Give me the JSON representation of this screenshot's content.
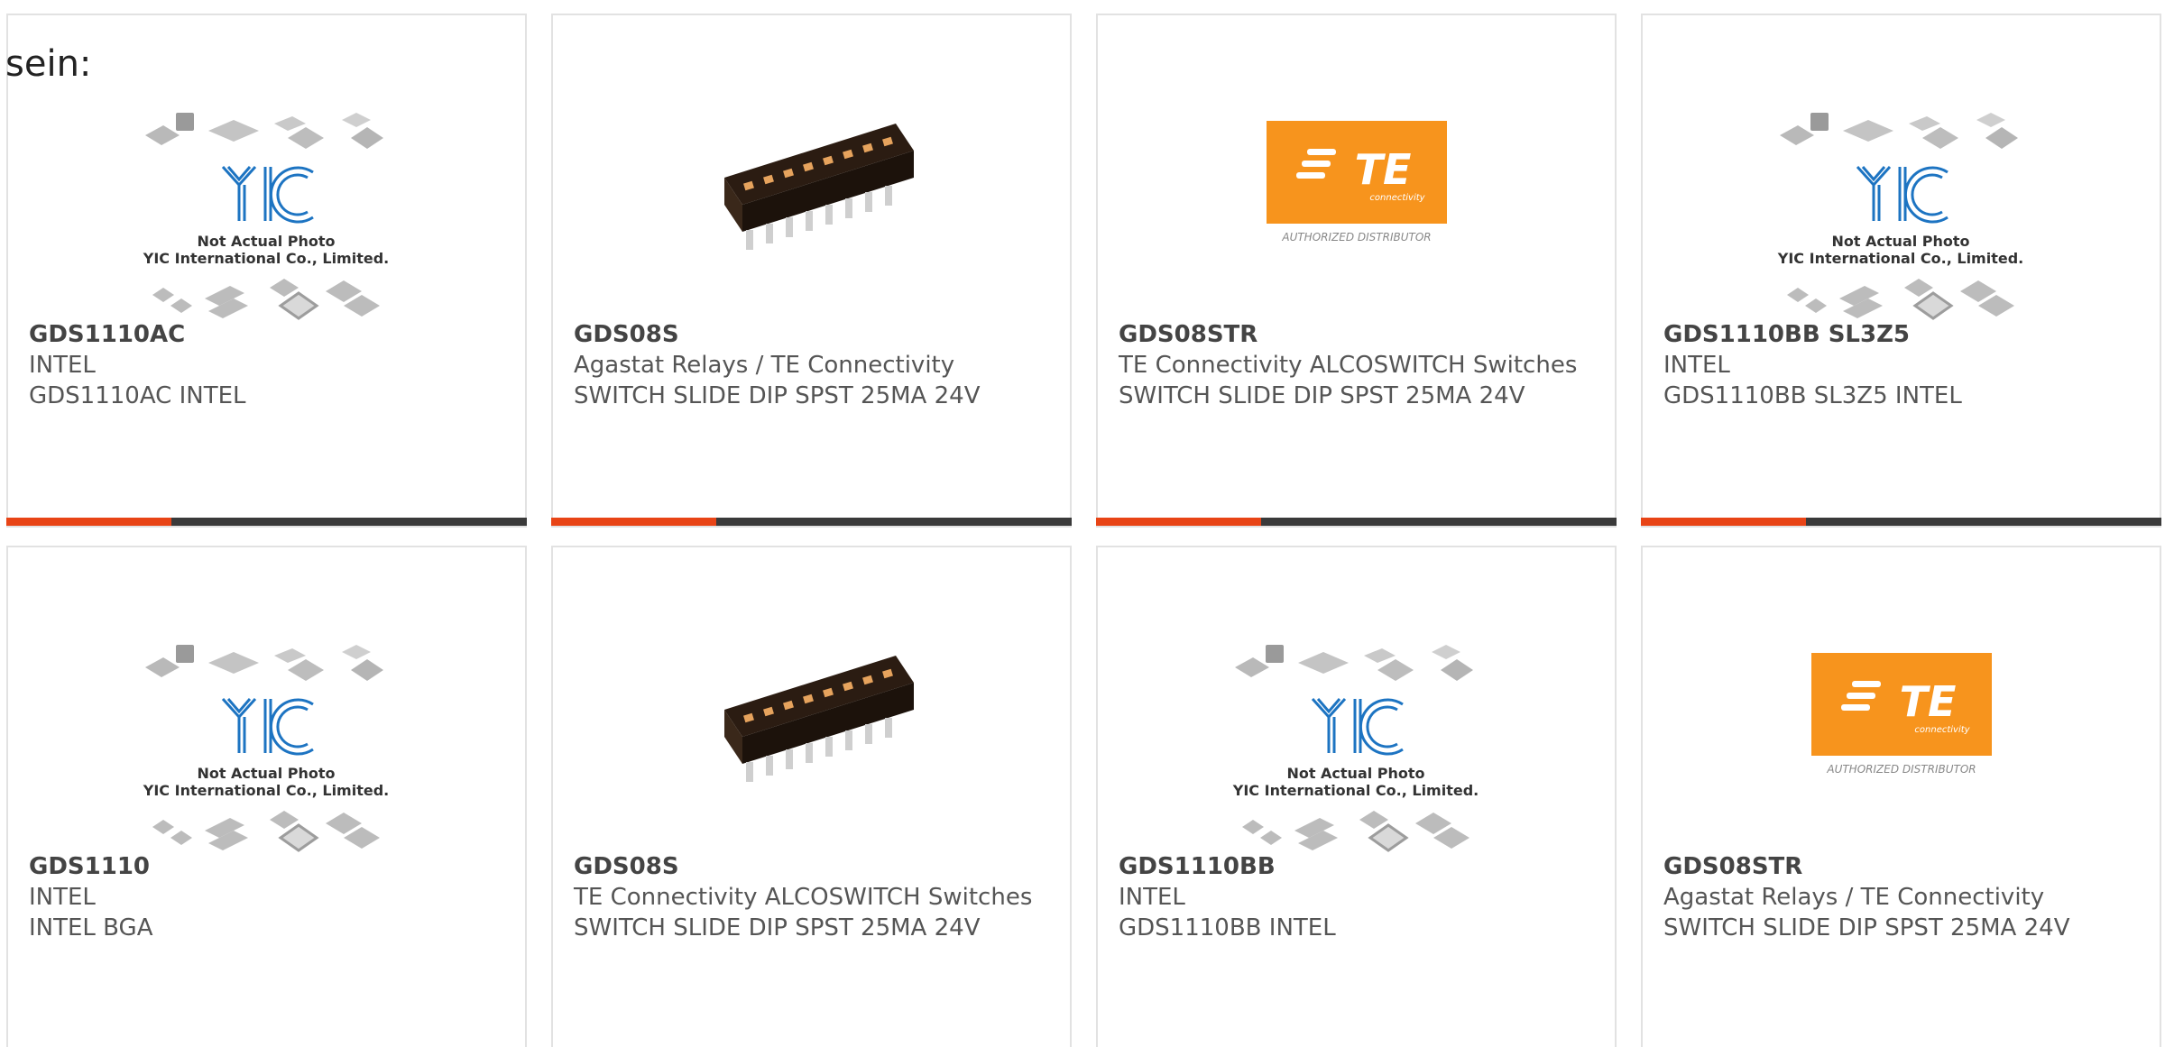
{
  "intro_text": "sein:",
  "colors": {
    "accent": "#e84416",
    "bar_dark": "#3a3a3a",
    "te_orange": "#f7941d"
  },
  "yic_placeholder": {
    "logo": "YIC",
    "line1": "Not Actual Photo",
    "line2": "YIC International Co., Limited."
  },
  "te_logo": {
    "brand": "TE",
    "sub": "connectivity",
    "caption": "AUTHORIZED DISTRIBUTOR"
  },
  "products": [
    {
      "image": "yic-placeholder",
      "part_number": "GDS1110AC",
      "manufacturer": "INTEL",
      "description": "GDS1110AC INTEL"
    },
    {
      "image": "dip-switch-photo",
      "part_number": "GDS08S",
      "manufacturer": "Agastat Relays / TE Connectivity",
      "description": "SWITCH SLIDE DIP SPST 25MA 24V"
    },
    {
      "image": "te-logo",
      "part_number": "GDS08STR",
      "manufacturer": "TE Connectivity ALCOSWITCH Switches",
      "description": "SWITCH SLIDE DIP SPST 25MA 24V"
    },
    {
      "image": "yic-placeholder",
      "part_number": "GDS1110BB SL3Z5",
      "manufacturer": "INTEL",
      "description": "GDS1110BB SL3Z5 INTEL"
    },
    {
      "image": "yic-placeholder",
      "part_number": "GDS1110",
      "manufacturer": "INTEL",
      "description": "INTEL BGA"
    },
    {
      "image": "dip-switch-photo",
      "part_number": "GDS08S",
      "manufacturer": "TE Connectivity ALCOSWITCH Switches",
      "description": "SWITCH SLIDE DIP SPST 25MA 24V"
    },
    {
      "image": "yic-placeholder",
      "part_number": "GDS1110BB",
      "manufacturer": "INTEL",
      "description": "GDS1110BB INTEL"
    },
    {
      "image": "te-logo",
      "part_number": "GDS08STR",
      "manufacturer": "Agastat Relays / TE Connectivity",
      "description": "SWITCH SLIDE DIP SPST 25MA 24V"
    }
  ]
}
